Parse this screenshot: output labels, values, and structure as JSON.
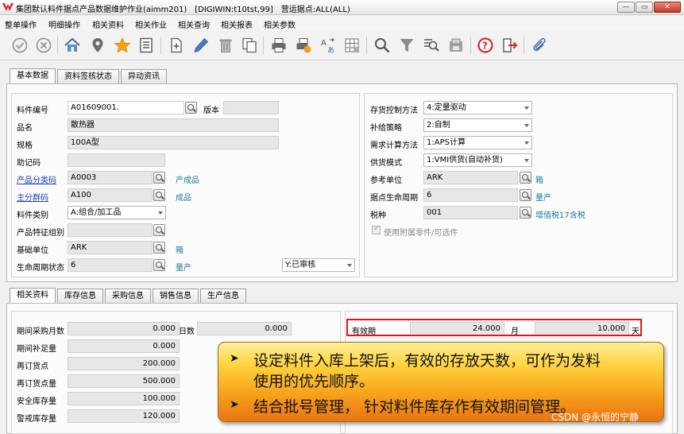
{
  "window": {
    "title": "集团默认料件据点产品数据维护作业(aimm201)　[DIGIWIN:t10tst,99]　营运据点:ALL(ALL)",
    "buttons": {
      "minimize": "—",
      "restore": "▭",
      "close": "✕"
    }
  },
  "menu": [
    "整单操作",
    "明细操作",
    "相关资料",
    "相关作业",
    "相关查询",
    "相关报表",
    "相关参数"
  ],
  "toolbar": [
    "confirm-icon",
    "cancel-icon",
    "home-icon",
    "location-icon",
    "star-icon",
    "list-icon",
    "new-icon",
    "edit-icon",
    "delete-icon",
    "copy-icon",
    "print-icon",
    "export-icon",
    "translate-icon",
    "grid-icon",
    "search-icon",
    "filter-icon",
    "query-icon",
    "save-icon",
    "help-icon",
    "exit-icon",
    "attach-icon"
  ],
  "top_tabs": [
    "基本数据",
    "资料签核状态",
    "异动资讯"
  ],
  "basic": {
    "item_no": {
      "label": "料件编号",
      "value": "A01609001."
    },
    "version": {
      "label": "版本",
      "value": ""
    },
    "name": {
      "label": "品名",
      "value": "散热器"
    },
    "spec": {
      "label": "规格",
      "value": "100A型"
    },
    "mnemonic": {
      "label": "助记码",
      "value": ""
    },
    "product_class": {
      "label": "产品分类码",
      "value": "A0003",
      "desc": "产成品"
    },
    "main_group": {
      "label": "主分群码",
      "value": "A100",
      "desc": "成品"
    },
    "item_type": {
      "label": "料件类别",
      "value": "A:组合/加工品"
    },
    "feature_group": {
      "label": "产品特征组别",
      "value": ""
    },
    "base_unit": {
      "label": "基础单位",
      "value": "ARK",
      "desc": "箱"
    },
    "lifecycle": {
      "label": "生命周期状态",
      "value": "6",
      "desc": "量产"
    },
    "review_status": {
      "value": "Y:已审核"
    },
    "inv_control": {
      "label": "存货控制方法",
      "value": "4:定量驱动"
    },
    "supply_policy": {
      "label": "补给策略",
      "value": "2:自制"
    },
    "demand_calc": {
      "label": "需求计算方法",
      "value": "1:APS计算"
    },
    "supply_mode": {
      "label": "供货模式",
      "value": "1:VMI供货(自动补货)"
    },
    "ref_unit": {
      "label": "参考单位",
      "value": "ARK",
      "desc": "箱"
    },
    "site_lifecycle": {
      "label": "据点生命周期",
      "value": "6",
      "desc": "量产"
    },
    "tax": {
      "label": "税种",
      "value": "001",
      "desc": "增值税17含税"
    },
    "use_accessory": {
      "label": "使用附属零件/可选件"
    }
  },
  "bottom_tabs": [
    "相关资料",
    "库存信息",
    "采购信息",
    "销售信息",
    "生产信息"
  ],
  "stock": {
    "purchase_months": {
      "label": "期间采购月数",
      "value": "0.000"
    },
    "days": {
      "label": "日数",
      "value": "0.000"
    },
    "replenish": {
      "label": "期间补足量",
      "value": "0.000"
    },
    "reorder_point": {
      "label": "再订货点",
      "value": "200.000"
    },
    "reorder_qty": {
      "label": "再订货点量",
      "value": "500.000"
    },
    "safety_stock": {
      "label": "安全库存量",
      "value": "100.000"
    },
    "warning_stock": {
      "label": "警戒库存量",
      "value": "120.000"
    },
    "validity": {
      "label": "有效期",
      "months": "24.000",
      "month_unit": "月",
      "days": "10.000",
      "day_unit": "天"
    }
  },
  "callout": {
    "line1": "设定料件入库上架后，有效的存放天数，可作为发料",
    "line2": "使用的优先顺序。",
    "line3": "结合批号管理， 针对料件库存作有效期间管理。",
    "bullet": "➤"
  },
  "watermark": "CSDN @永恒的宁静",
  "colors": {
    "link": "#1a3fb8",
    "desc": "#1e7d9b",
    "highlight": "#e01616",
    "callout": "#ffd23c"
  }
}
